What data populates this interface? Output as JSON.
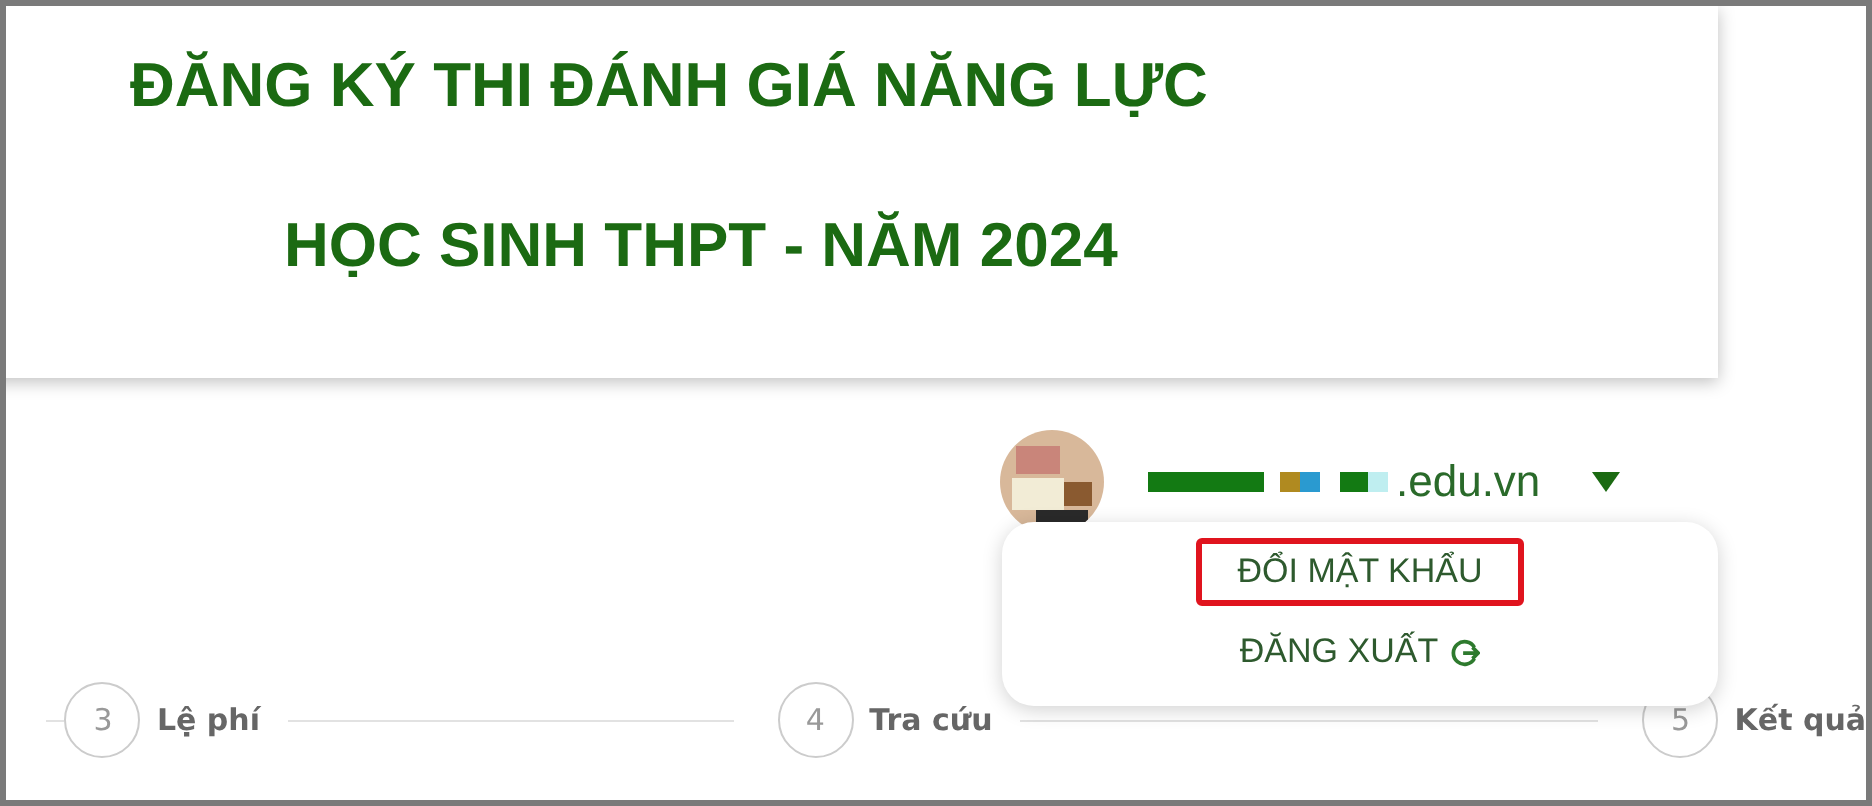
{
  "header": {
    "title_lines": [
      "ĐĂNG KÝ THI ĐÁNH GIÁ NĂNG LỰC",
      "HỌC SINH THPT - NĂM 2024"
    ]
  },
  "user": {
    "email_visible": ".edu.vn",
    "menu_open": true
  },
  "user_menu": [
    {
      "label": "ĐỔI MẬT KHẨU",
      "highlighted": true,
      "kind": "plain"
    },
    {
      "label": "ĐĂNG XUẤT",
      "highlighted": false,
      "kind": "logout"
    }
  ],
  "steps": [
    {
      "number": "3",
      "label": "Lệ phí"
    },
    {
      "number": "4",
      "label": "Tra cứu"
    },
    {
      "number": "5",
      "label": "Kết quả"
    }
  ]
}
